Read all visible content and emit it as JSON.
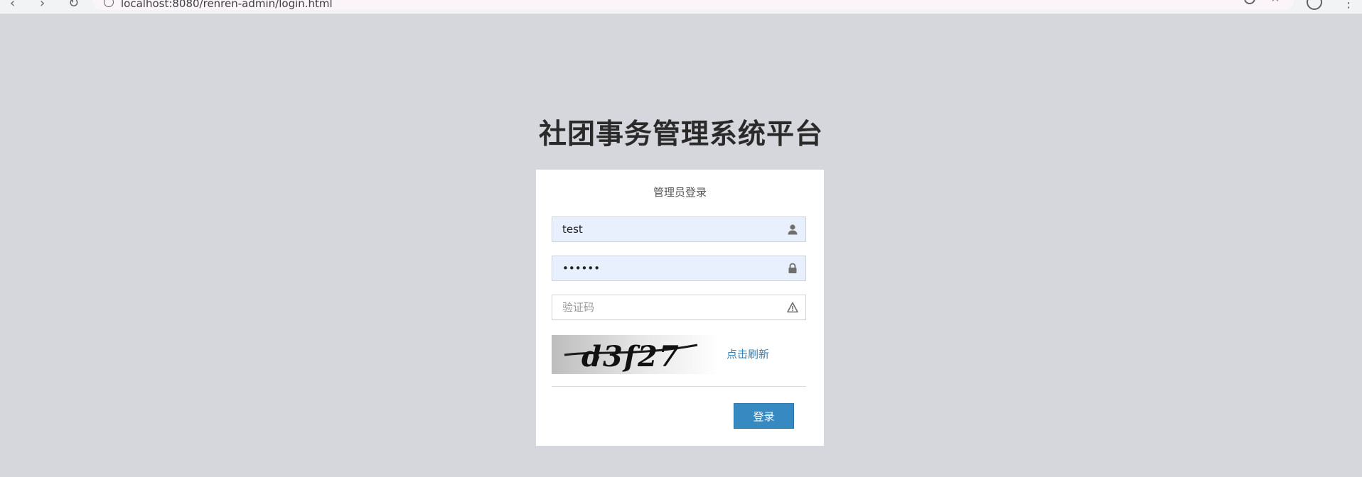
{
  "browser": {
    "url": "localhost:8080/renren-admin/login.html"
  },
  "page": {
    "title": "社团事务管理系统平台"
  },
  "login_panel": {
    "heading": "管理员登录",
    "username": {
      "value": "test",
      "icon": "user-icon"
    },
    "password": {
      "value": "••••••",
      "icon": "lock-icon"
    },
    "captcha": {
      "placeholder": "验证码",
      "value": "",
      "icon": "warning-icon"
    },
    "captcha_image_text": "d3f27",
    "refresh_label": "点击刷新",
    "login_button_label": "登录"
  },
  "colors": {
    "background": "#d6d7dc",
    "accent_button": "#3789c1",
    "link": "#3b7fb3",
    "autofill_field": "#e8f0fe"
  }
}
